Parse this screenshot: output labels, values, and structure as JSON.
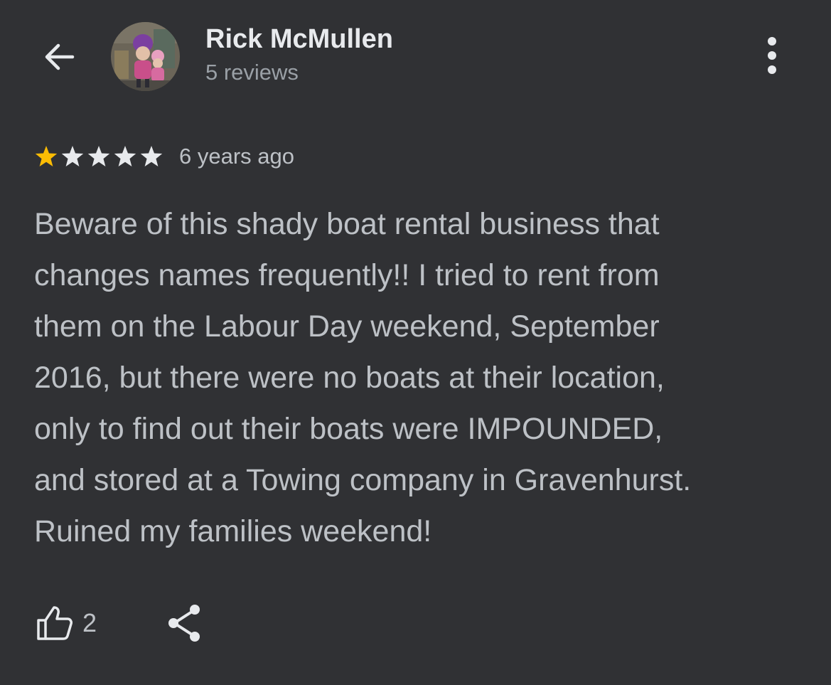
{
  "header": {
    "back_icon": "arrow-left-icon",
    "reviewer_name": "Rick McMullen",
    "review_count": "5 reviews",
    "more_icon": "more-vertical-icon"
  },
  "review": {
    "rating": 1,
    "max_rating": 5,
    "star_filled_color": "#fbbc04",
    "star_empty_color": "#e8eaed",
    "time_ago": "6 years ago",
    "text": "Beware of this shady boat rental business that\nchanges names frequently!! I tried to rent from\nthem on the Labour Day weekend, September\n2016, but there were no boats at their location,\nonly to find out their boats were IMPOUNDED,\nand stored at a Towing company in Gravenhurst.\nRuined my families weekend!"
  },
  "actions": {
    "like_icon": "thumbs-up-icon",
    "like_count": "2",
    "share_icon": "share-icon"
  },
  "theme": {
    "background": "#303134",
    "primary_text": "#e8eaed",
    "secondary_text": "#9aa0a6"
  }
}
